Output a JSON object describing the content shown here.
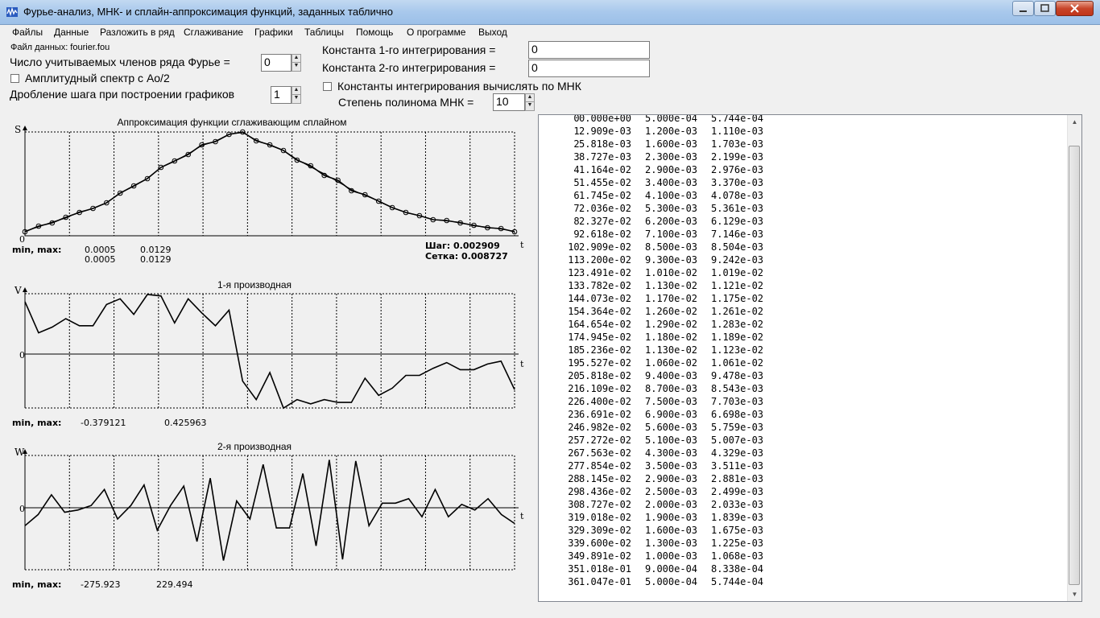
{
  "window": {
    "title": "Фурье-анализ, МНК- и сплайн-аппроксимация функций, заданных таблично",
    "icon": "app-waveform-icon",
    "controls": [
      "minimize-icon",
      "maximize-icon",
      "close-icon"
    ]
  },
  "menu": [
    "Файлы",
    "Данные",
    "Разложить в ряд",
    "Сглаживание",
    "Графики",
    "Таблицы",
    "Помощь",
    "О программе",
    "Выход"
  ],
  "params": {
    "data_file_label": "Файл данных: fourier.fou",
    "fourier_terms_label": "Число учитываемых членов ряда Фурье =",
    "fourier_terms_value": "0",
    "amplitude_label": "Амплитудный спектр с Ao/2",
    "amplitude_checked": false,
    "step_division_label": "Дробление шага при построении графиков",
    "step_division_value": "1",
    "const1_label": "Константа 1-го интегрирования =",
    "const1_value": "0",
    "const2_label": "Константа 2-го интегрирования =",
    "const2_value": "0",
    "mnk_constants_label": "Константы интегрирования вычислять по МНК",
    "mnk_constants_checked": false,
    "poly_degree_label": "Степень полинома МНК =",
    "poly_degree_value": "10"
  },
  "charts": {
    "spline": {
      "title": "Аппроксимация функции сглаживающим сплайном",
      "y_letter": "S",
      "x_letter": "t",
      "zero": "0",
      "stats_label": "min, max:",
      "min1": "0.0005",
      "max1": "0.0129",
      "min2": "0.0005",
      "max2": "0.0129",
      "step": "Шаг: 0.002909",
      "grid": "Сетка: 0.008727"
    },
    "d1": {
      "title": "1-я производная",
      "y_letter": "V",
      "x_letter": "t",
      "zero": "0",
      "stats_label": "min, max:",
      "min": "-0.379121",
      "max": "0.425963"
    },
    "d2": {
      "title": "2-я производная",
      "y_letter": "W",
      "x_letter": "t",
      "zero": "0",
      "stats_label": "min, max:",
      "min": "-275.923",
      "max": "229.494"
    }
  },
  "chart_data": [
    {
      "type": "line",
      "title": "Аппроксимация функции сглаживающим сплайном",
      "xlabel": "t",
      "ylabel": "S",
      "x": [
        0.0,
        0.002909,
        0.005818,
        0.008727,
        0.01164,
        0.01455,
        0.01745,
        0.02036,
        0.02327,
        0.02618,
        0.02909,
        0.032,
        0.03491,
        0.03782,
        0.04073,
        0.04364,
        0.04654,
        0.04945,
        0.05236,
        0.05527,
        0.05818,
        0.06109,
        0.064,
        0.06691,
        0.06982,
        0.07272,
        0.07563,
        0.07854,
        0.08145,
        0.08436,
        0.08727,
        0.09018,
        0.09309,
        0.096,
        0.09891,
        0.1018,
        0.1047
      ],
      "series": [
        {
          "values": [
            0.0005,
            0.0012,
            0.0016,
            0.0023,
            0.0029,
            0.0034,
            0.0041,
            0.0053,
            0.0062,
            0.0071,
            0.0085,
            0.0093,
            0.0101,
            0.0113,
            0.0117,
            0.0126,
            0.0129,
            0.0118,
            0.0113,
            0.0106,
            0.0094,
            0.0087,
            0.0075,
            0.0069,
            0.0056,
            0.0051,
            0.0043,
            0.0035,
            0.0029,
            0.0025,
            0.002,
            0.0019,
            0.0016,
            0.0013,
            0.001,
            0.0009,
            0.0005
          ],
          "marker": "circle"
        },
        {
          "values": [
            0.000574,
            0.00111,
            0.001703,
            0.002199,
            0.002976,
            0.00337,
            0.004078,
            0.005361,
            0.006129,
            0.007146,
            0.008504,
            0.009242,
            0.01019,
            0.01121,
            0.01175,
            0.01261,
            0.01283,
            0.01189,
            0.01123,
            0.01061,
            0.009478,
            0.008543,
            0.007703,
            0.006698,
            0.005759,
            0.005007,
            0.004329,
            0.003511,
            0.002881,
            0.002499,
            0.002033,
            0.001839,
            0.001675,
            0.001225,
            0.001068,
            0.000834,
            0.000574
          ]
        }
      ]
    },
    {
      "type": "line",
      "title": "1-я производная",
      "xlabel": "t",
      "ylabel": "V",
      "x": [
        0.0,
        0.002909,
        0.005818,
        0.008727,
        0.01164,
        0.01455,
        0.01745,
        0.02036,
        0.02327,
        0.02618,
        0.02909,
        0.032,
        0.03491,
        0.03782,
        0.04073,
        0.04364,
        0.04654,
        0.04945,
        0.05236,
        0.05527,
        0.05818,
        0.06109,
        0.064,
        0.06691,
        0.06982,
        0.07272,
        0.07563,
        0.07854,
        0.08145,
        0.08436,
        0.08727,
        0.09018,
        0.09309,
        0.096,
        0.09891,
        0.1018,
        0.1047
      ],
      "series": [
        {
          "values": [
            0.37,
            0.15,
            0.19,
            0.25,
            0.2,
            0.2,
            0.35,
            0.39,
            0.28,
            0.42,
            0.41,
            0.22,
            0.39,
            0.29,
            0.2,
            0.31,
            -0.19,
            -0.32,
            -0.13,
            -0.38,
            -0.32,
            -0.35,
            -0.32,
            -0.34,
            -0.34,
            -0.17,
            -0.29,
            -0.24,
            -0.15,
            -0.15,
            -0.1,
            -0.06,
            -0.11,
            -0.11,
            -0.07,
            -0.05,
            -0.25
          ]
        }
      ]
    },
    {
      "type": "line",
      "title": "2-я производная",
      "xlabel": "t",
      "ylabel": "W",
      "x": [
        0.0,
        0.002909,
        0.005818,
        0.008727,
        0.01164,
        0.01455,
        0.01745,
        0.02036,
        0.02327,
        0.02618,
        0.02909,
        0.032,
        0.03491,
        0.03782,
        0.04073,
        0.04364,
        0.04654,
        0.04945,
        0.05236,
        0.05527,
        0.05818,
        0.06109,
        0.064,
        0.06691,
        0.06982,
        0.07272,
        0.07563,
        0.07854,
        0.08145,
        0.08436,
        0.08727,
        0.09018,
        0.09309,
        0.096,
        0.09891,
        0.1018,
        0.1047
      ],
      "series": [
        {
          "values": [
            -80,
            -30,
            57,
            -20,
            -10,
            10,
            80,
            -50,
            10,
            100,
            -100,
            10,
            95,
            -150,
            130,
            -235,
            30,
            -50,
            190,
            -90,
            -90,
            150,
            -170,
            210,
            -230,
            205,
            -80,
            20,
            20,
            40,
            -40,
            80,
            -40,
            15,
            -10,
            40,
            -30,
            -70
          ]
        }
      ]
    }
  ],
  "table": {
    "rows": [
      [
        "0",
        "0.000e+00",
        "5.000e-04",
        "5.744e-04"
      ],
      [
        "1",
        "2.909e-03",
        "1.200e-03",
        "1.110e-03"
      ],
      [
        "2",
        "5.818e-03",
        "1.600e-03",
        "1.703e-03"
      ],
      [
        "3",
        "8.727e-03",
        "2.300e-03",
        "2.199e-03"
      ],
      [
        "4",
        "1.164e-02",
        "2.900e-03",
        "2.976e-03"
      ],
      [
        "5",
        "1.455e-02",
        "3.400e-03",
        "3.370e-03"
      ],
      [
        "6",
        "1.745e-02",
        "4.100e-03",
        "4.078e-03"
      ],
      [
        "7",
        "2.036e-02",
        "5.300e-03",
        "5.361e-03"
      ],
      [
        "8",
        "2.327e-02",
        "6.200e-03",
        "6.129e-03"
      ],
      [
        "9",
        "2.618e-02",
        "7.100e-03",
        "7.146e-03"
      ],
      [
        "10",
        "2.909e-02",
        "8.500e-03",
        "8.504e-03"
      ],
      [
        "11",
        "3.200e-02",
        "9.300e-03",
        "9.242e-03"
      ],
      [
        "12",
        "3.491e-02",
        "1.010e-02",
        "1.019e-02"
      ],
      [
        "13",
        "3.782e-02",
        "1.130e-02",
        "1.121e-02"
      ],
      [
        "14",
        "4.073e-02",
        "1.170e-02",
        "1.175e-02"
      ],
      [
        "15",
        "4.364e-02",
        "1.260e-02",
        "1.261e-02"
      ],
      [
        "16",
        "4.654e-02",
        "1.290e-02",
        "1.283e-02"
      ],
      [
        "17",
        "4.945e-02",
        "1.180e-02",
        "1.189e-02"
      ],
      [
        "18",
        "5.236e-02",
        "1.130e-02",
        "1.123e-02"
      ],
      [
        "19",
        "5.527e-02",
        "1.060e-02",
        "1.061e-02"
      ],
      [
        "20",
        "5.818e-02",
        "9.400e-03",
        "9.478e-03"
      ],
      [
        "21",
        "6.109e-02",
        "8.700e-03",
        "8.543e-03"
      ],
      [
        "22",
        "6.400e-02",
        "7.500e-03",
        "7.703e-03"
      ],
      [
        "23",
        "6.691e-02",
        "6.900e-03",
        "6.698e-03"
      ],
      [
        "24",
        "6.982e-02",
        "5.600e-03",
        "5.759e-03"
      ],
      [
        "25",
        "7.272e-02",
        "5.100e-03",
        "5.007e-03"
      ],
      [
        "26",
        "7.563e-02",
        "4.300e-03",
        "4.329e-03"
      ],
      [
        "27",
        "7.854e-02",
        "3.500e-03",
        "3.511e-03"
      ],
      [
        "28",
        "8.145e-02",
        "2.900e-03",
        "2.881e-03"
      ],
      [
        "29",
        "8.436e-02",
        "2.500e-03",
        "2.499e-03"
      ],
      [
        "30",
        "8.727e-02",
        "2.000e-03",
        "2.033e-03"
      ],
      [
        "31",
        "9.018e-02",
        "1.900e-03",
        "1.839e-03"
      ],
      [
        "32",
        "9.309e-02",
        "1.600e-03",
        "1.675e-03"
      ],
      [
        "33",
        "9.600e-02",
        "1.300e-03",
        "1.225e-03"
      ],
      [
        "34",
        "9.891e-02",
        "1.000e-03",
        "1.068e-03"
      ],
      [
        "35",
        "1.018e-01",
        "9.000e-04",
        "8.338e-04"
      ],
      [
        "36",
        "1.047e-01",
        "5.000e-04",
        "5.744e-04"
      ]
    ]
  }
}
